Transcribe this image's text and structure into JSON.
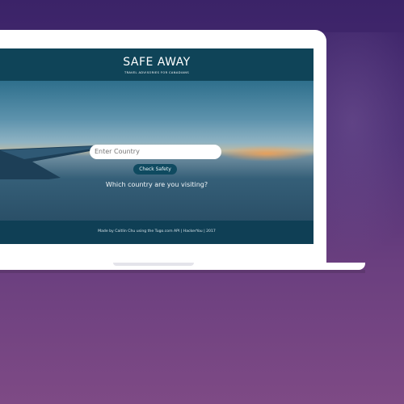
{
  "site": {
    "title": "SAFE AWAY",
    "tagline": "TRAVEL ADVISORIES FOR CANADIANS"
  },
  "search": {
    "question": "Which country are you visiting?",
    "placeholder": "Enter Country",
    "button_label": "Check Safety"
  },
  "footer": {
    "text": "Made by Caitlin Chu using the Tugo.com API | HackerYou | 2017"
  },
  "colors": {
    "background_top": "#3b2368",
    "background_bottom": "#7e4a85",
    "header": "#0f4458",
    "button": "#0f4a60"
  }
}
